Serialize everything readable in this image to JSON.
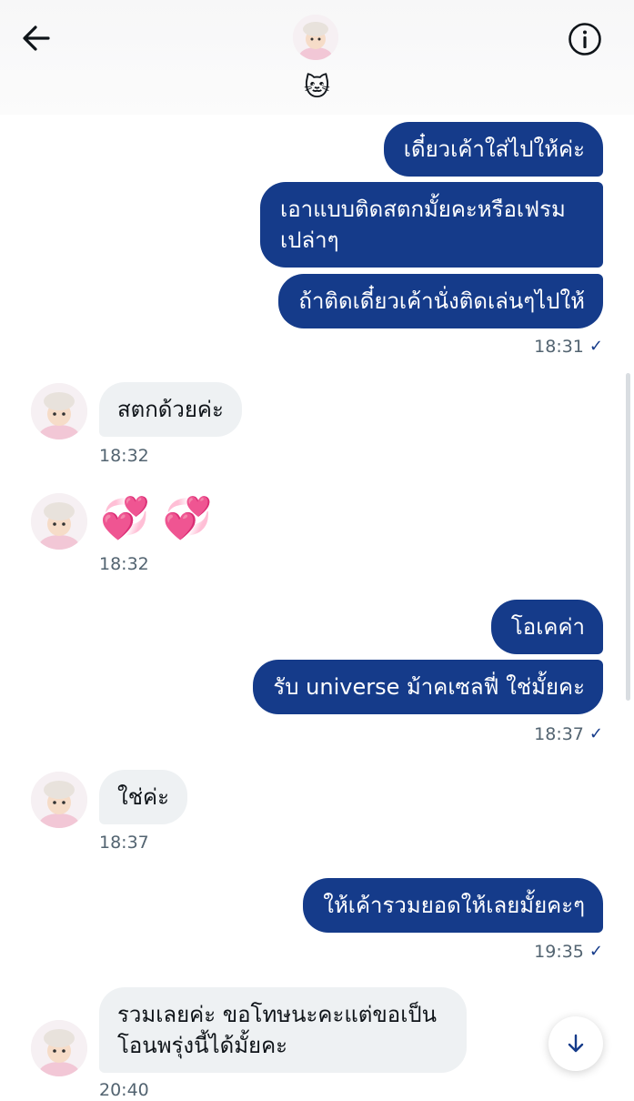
{
  "header": {
    "back_icon": "arrow-left-icon",
    "info_icon": "info-circle-icon",
    "contact_name": "🐱"
  },
  "messages": [
    {
      "from": "me",
      "text": "เดี๋ยวเค้าใส่ไปให้ค่ะ"
    },
    {
      "from": "me",
      "text_line1": "เอาแบบติดสตกมั้ยคะหรือเฟรม",
      "text_line2": "เปล่าๆ"
    },
    {
      "from": "me",
      "text": "ถ้าติดเดี๋ยวเค้านั่งติดเล่นๆไปให้",
      "time": "18:31"
    },
    {
      "from": "them",
      "text": "สตกด้วยค่ะ",
      "time": "18:32"
    },
    {
      "from": "them",
      "emojis": [
        "💞",
        "💞"
      ],
      "time": "18:32"
    },
    {
      "from": "me",
      "text": "โอเคค่า"
    },
    {
      "from": "me",
      "text": "รับ universe ม้าคเซลฟี่ ใช่มั้ยคะ",
      "time": "18:37"
    },
    {
      "from": "them",
      "text": "ใช่ค่ะ",
      "time": "18:37"
    },
    {
      "from": "me",
      "text": "ให้เค้ารวมยอดให้เลยมั้ยคะๆ",
      "time": "19:35"
    },
    {
      "from": "them",
      "text_line1": "รวมเลยค่ะ ขอโทษนะคะแต่ขอเป็น",
      "text_line2": "โอนพรุ่งนี้ได้มั้ยคะ",
      "time": "20:40"
    }
  ],
  "scroll_down_icon": "arrow-down-icon",
  "colors": {
    "sent_bubble": "#153b8a",
    "received_bubble": "#eef1f3",
    "timestamp": "#536471"
  }
}
